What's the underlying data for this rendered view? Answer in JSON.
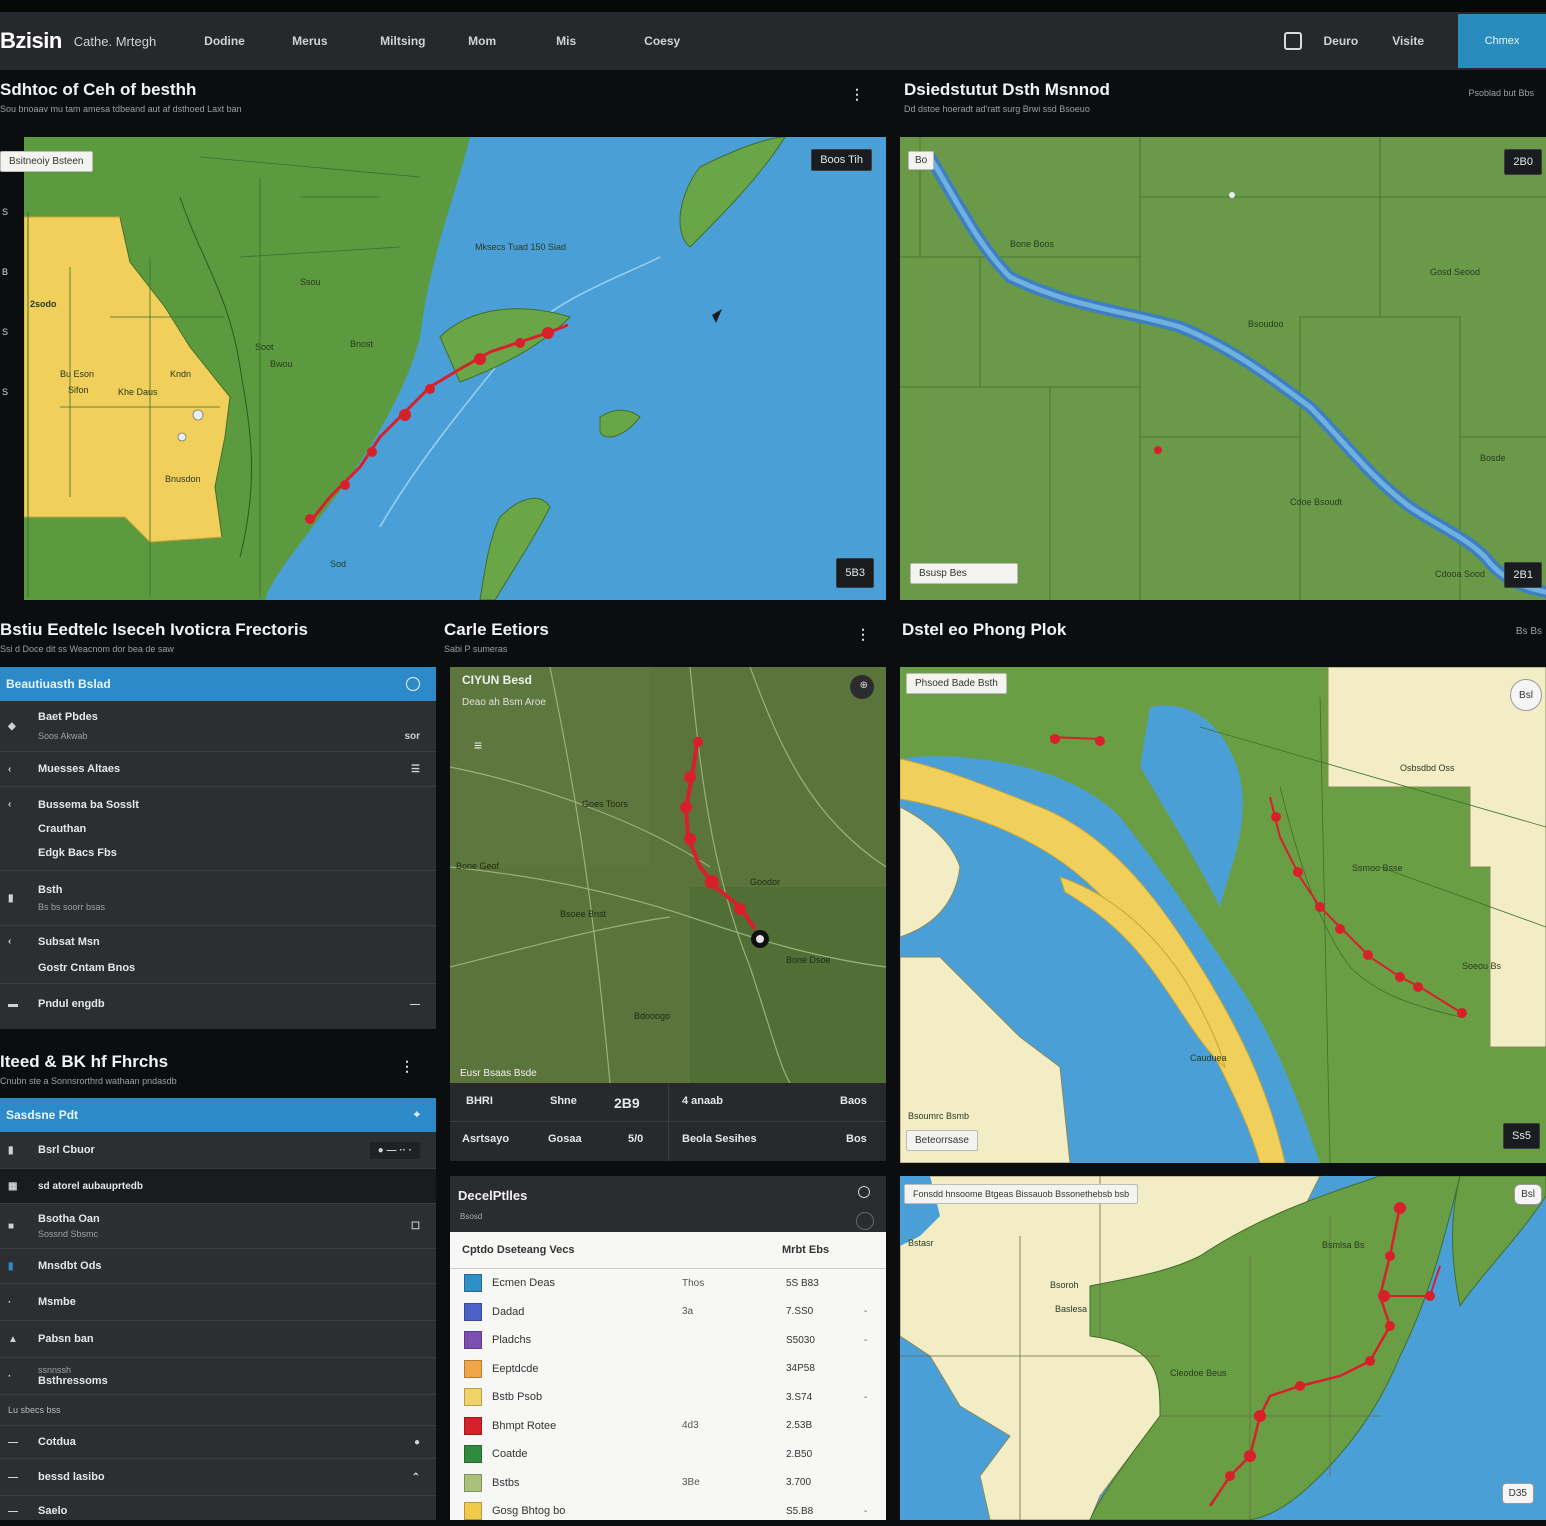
{
  "topbar": {
    "brand": "Bzisin",
    "brand_sub": "Cathe. Mrtegh",
    "nav": [
      "Dodine",
      "Merus",
      "Miltsing",
      "Mom",
      "Mis",
      "Coesy"
    ],
    "right_labels": [
      "Deuro",
      "Visite"
    ],
    "cta": "Chmex"
  },
  "panel1": {
    "title": "Sdhtoc of Ceh of besthh",
    "subtitle": "Sou bnoaav mu tam amesa tdbeand aut af dsthoed Laxt ban",
    "chip": "Bsitneoiy Bsteen",
    "badge_top": "Boos Tih",
    "badge_bottom": "5B3",
    "left_rail": [
      "S",
      "B",
      "S",
      "S"
    ],
    "labels": {
      "yellow_a": "2sodo",
      "yellow_b": "Bu Eson",
      "yellow_c": "Sifon",
      "yellow_d": "Khe Daus",
      "yellow_e": "Kndn",
      "yellow_f": "Bnusdon",
      "water": "Mksecs Tuad 150 Siad",
      "land_a": "Soot",
      "land_b": "Bwou",
      "land_c": "Ssou",
      "land_d": "Bnost",
      "land_e": "Sod"
    }
  },
  "panel2": {
    "title": "Dsiedstutut Dsth Msnnod",
    "subtitle": "Dd dstoe hoeradt ad'ratt surg Brwi ssd Bsoeuo",
    "right_meta": "Psoblad but Bbs",
    "chip_top": "Bo",
    "chip_bottom": "Bsusp Bes",
    "badge_top": "2B0",
    "badge_bottom": "2B1",
    "labels": {
      "a": "Bone Boos",
      "b": "Bsoudoo",
      "c": "Cdoe Bsoudt",
      "d": "Gosd Seood",
      "e": "Bosde",
      "f": "Cdooa Sood"
    }
  },
  "panel3": {
    "title": "Bstiu Eedtelc Iseceh Ivoticra Frectoris",
    "subtitle": "Ssi d Doce dit ss Weacnom dor bea de saw",
    "header": "Beautiuasth Bslad",
    "rows": [
      {
        "icon": "◆",
        "label": "Baet Pbdes",
        "sub": "Soos Akwab",
        "tail": "sor"
      },
      {
        "icon": "‹",
        "label": "Muesses Altaes",
        "sub": "",
        "tail": "☰"
      },
      {
        "icon": "‹",
        "label": "Bussema ba Sosslt",
        "sub": "",
        "tail": ""
      },
      {
        "icon": "‹",
        "label": "Crauthan",
        "sub": "",
        "tail": ""
      },
      {
        "icon": "‹",
        "label": "Edgk Bacs Fbs",
        "sub": "",
        "tail": ""
      },
      {
        "icon": "▮",
        "label": "Bsth",
        "sub": "Bs bs soorr bsas",
        "tail": ""
      },
      {
        "icon": "‹",
        "label": "Subsat Msn",
        "sub": "",
        "tail": ""
      },
      {
        "icon": "▮",
        "label": "Gostr Cntam Bnos",
        "sub": "",
        "tail": ""
      },
      {
        "icon": "▬",
        "label": "Pndul engdb",
        "sub": "",
        "tail": "—"
      }
    ]
  },
  "panel4": {
    "title": "Iteed & BK hf Fhrchs",
    "subtitle": "Cnubn ste a Sonnsrorthrd wathaan pndasdb",
    "header": "Sasdsne Pdt",
    "search_label": "Bsrl Cbuor",
    "search_value": "● — ·· ·",
    "filter_row": "sd atorel aubauprtedb",
    "rows": [
      {
        "icon": "■",
        "label": "Bsotha Oan",
        "sub": "Sossnd Sbsmc",
        "tail": "☐"
      },
      {
        "icon": "▮",
        "label": "Mnsdbt Ods",
        "sub": "",
        "tail": ""
      },
      {
        "icon": "·",
        "label": "Msmbe",
        "sub": "",
        "tail": ""
      },
      {
        "icon": "▲",
        "label": "Pabsn ban",
        "sub": "",
        "tail": ""
      },
      {
        "icon": "·",
        "label": "Bsthressoms",
        "sub": "ssnnssh",
        "tail": ""
      },
      {
        "icon": "",
        "label": "Lu sbecs bss",
        "sub": "",
        "tail": ""
      },
      {
        "icon": "—",
        "label": "Cotdua",
        "sub": "",
        "tail": "●"
      },
      {
        "icon": "—",
        "label": "bessd lasibo",
        "sub": "",
        "tail": "⌃"
      },
      {
        "icon": "—",
        "label": "Saelo",
        "sub": "",
        "tail": ""
      }
    ]
  },
  "panel5": {
    "title": "Carle Eetiors",
    "subtitle": "Sabi P sumeras",
    "overlay_title": "CIYUN Besd",
    "overlay_sub": "Deao ah Bsm Aroe",
    "footer_label": "Eusr Bsaas Bsde",
    "labels": {
      "a": "Goes Toors",
      "b": "Bone Geof",
      "c": "Bsoee Bnst",
      "d": "Goodor",
      "e": "Bone Dsoe",
      "f": "Bdooogo"
    },
    "stats": [
      [
        "BHRI",
        "Shne",
        "2B9",
        "4 anaab",
        "Baos"
      ],
      [
        "Asrtsayo",
        "Gosaa",
        "5/0",
        "Beola Sesihes",
        "Bos"
      ]
    ]
  },
  "panel6": {
    "title": "Dstel eo Phong Plok",
    "right_meta": "Bs Bs",
    "chip_top": "Phsoed Bade Bsth",
    "chip_bottom": "Beteorrsase",
    "badge_round": "Bsl",
    "badge_bottom": "Ss5",
    "labels": {
      "a": "Osbsdbd Oss",
      "b": "Ssmoo Bsse",
      "c": "Cauduea",
      "d": "Soeou Bs",
      "e": "Bsoumrc Bsmb"
    }
  },
  "panel7": {
    "title": "DecelPtlles",
    "subtitle": "Bsosd",
    "columns": [
      "Cptdo Dseteang Vecs",
      "",
      "Mrbt Ebs",
      ""
    ],
    "rows": [
      {
        "color": "#2f8fc7",
        "label": "Ecmen Deas",
        "c2": "Thos",
        "c3": "5S B83",
        "c4": ""
      },
      {
        "color": "#4b62c8",
        "label": "Dadad",
        "c2": "3a",
        "c3": "7.SS0",
        "c4": "-"
      },
      {
        "color": "#7d4fb0",
        "label": "Pladchs",
        "c2": "",
        "c3": "S5030",
        "c4": "-"
      },
      {
        "color": "#f0a648",
        "label": "Eeptdcde",
        "c2": "",
        "c3": "34P58",
        "c4": ""
      },
      {
        "color": "#f2d36b",
        "label": "Bstb Psob",
        "c2": "",
        "c3": "3.S74",
        "c4": "-"
      },
      {
        "color": "#d8202b",
        "label": "Bhmpt Rotee",
        "c2": "4d3",
        "c3": "2.53B",
        "c4": ""
      },
      {
        "color": "#2f8c3e",
        "label": "Coatde",
        "c2": "",
        "c3": "2.B50",
        "c4": ""
      },
      {
        "color": "#a9c27a",
        "label": "Bstbs",
        "c2": "3Be",
        "c3": "3.700",
        "c4": ""
      },
      {
        "color": "#f0ca4a",
        "label": "Gosg Bhtog bo",
        "c2": "",
        "c3": "S5.B8",
        "c4": "-"
      }
    ]
  },
  "panel8": {
    "chip_top": "Fonsdd hnsoome Btgeas Bissauob Bssonethebsb bsb",
    "badge_top": "Bsl",
    "badge_bottom": "D35",
    "labels": {
      "a": "Bsoroh",
      "b": "Baslesa",
      "c": "Cleodoe Beus",
      "d": "Bsmlsa Bs",
      "e": "Bstasr"
    }
  }
}
